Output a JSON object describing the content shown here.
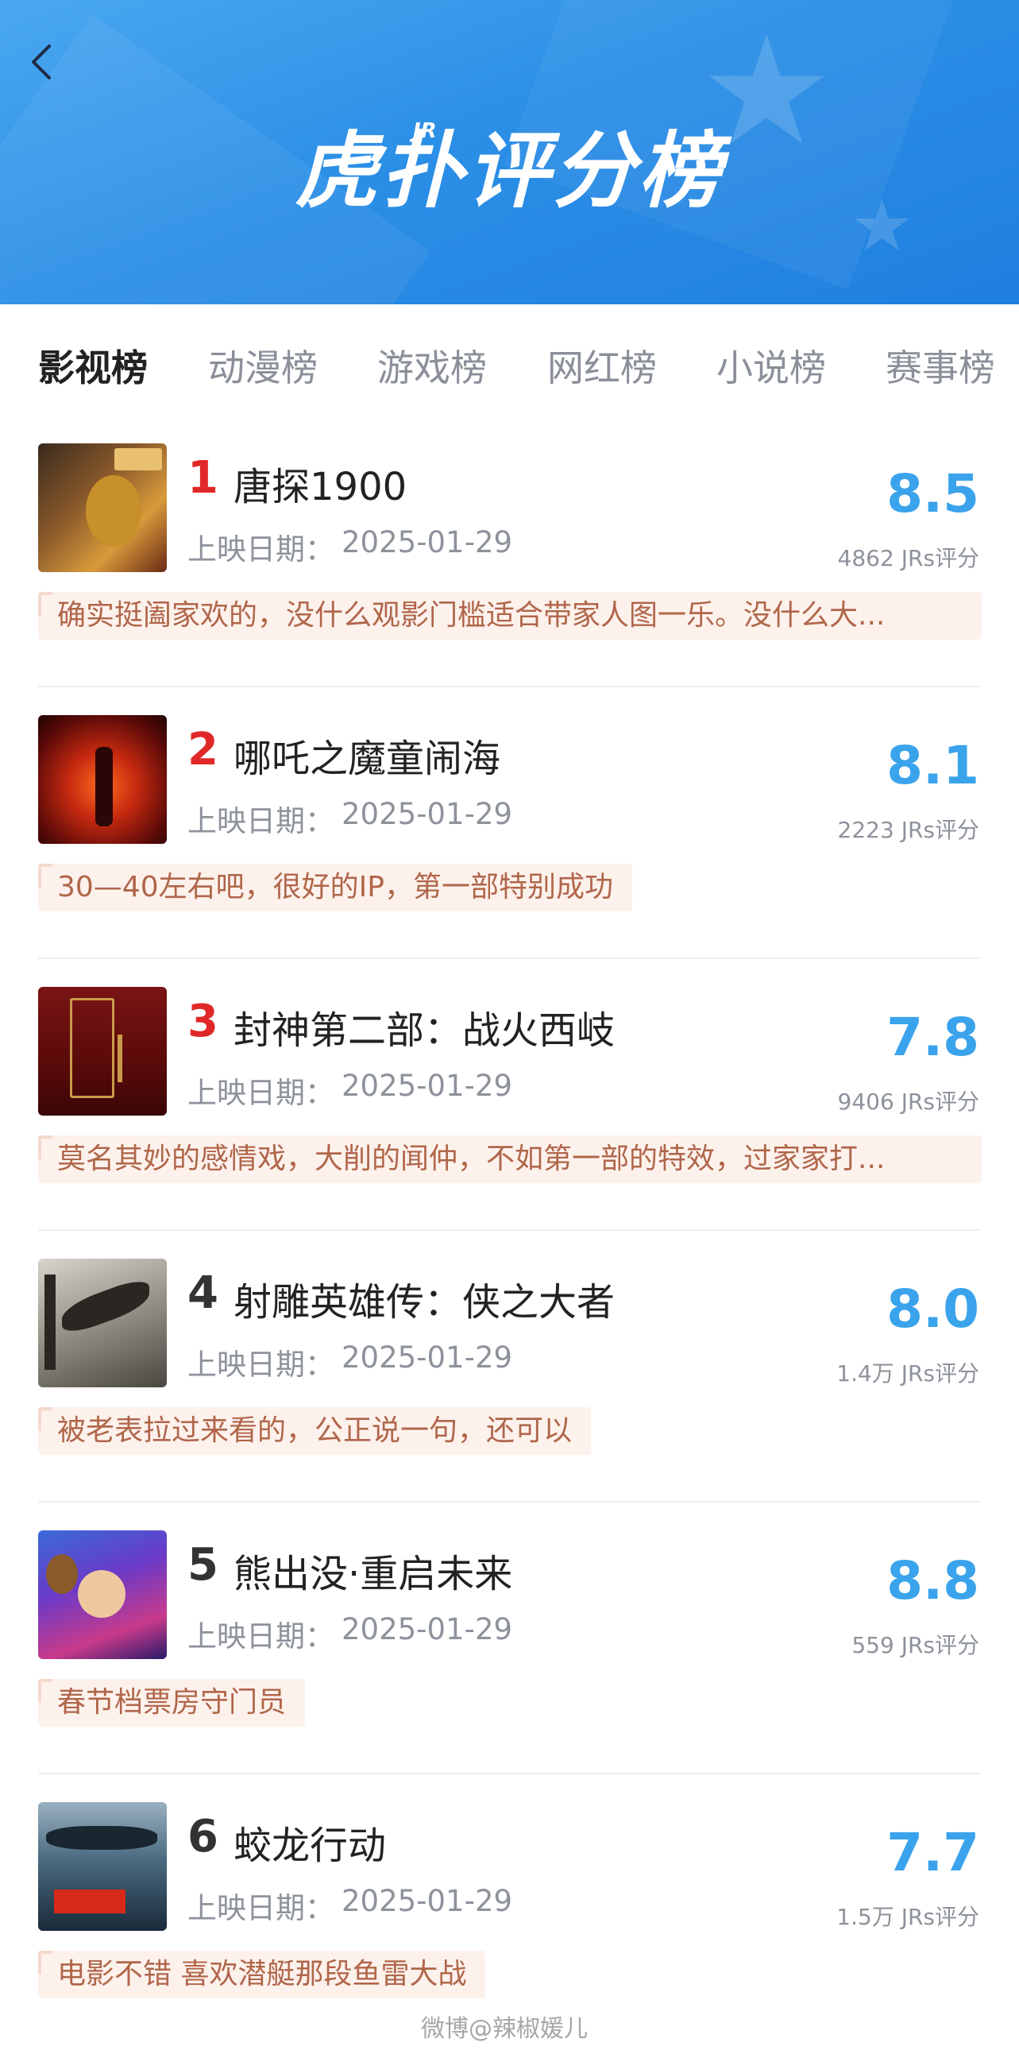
{
  "header": {
    "brand_sup": "JR",
    "brand": "虎扑评分榜"
  },
  "tabs": [
    "影视榜",
    "动漫榜",
    "游戏榜",
    "网红榜",
    "小说榜",
    "赛事榜"
  ],
  "date_label": "上映日期：",
  "items": [
    {
      "rank": "1",
      "title": "唐探1900",
      "date": "2025-01-29",
      "score": "8.5",
      "count": "4862 JRs评分",
      "comment": "确实挺阖家欢的，没什么观影门槛适合带家人图一乐。没什么大..."
    },
    {
      "rank": "2",
      "title": "哪吒之魔童闹海",
      "date": "2025-01-29",
      "score": "8.1",
      "count": "2223 JRs评分",
      "comment": "30—40左右吧，很好的IP，第一部特别成功"
    },
    {
      "rank": "3",
      "title": "封神第二部：战火西岐",
      "date": "2025-01-29",
      "score": "7.8",
      "count": "9406 JRs评分",
      "comment": "莫名其妙的感情戏，大削的闻仲，不如第一部的特效，过家家打..."
    },
    {
      "rank": "4",
      "title": "射雕英雄传：侠之大者",
      "date": "2025-01-29",
      "score": "8.0",
      "count": "1.4万 JRs评分",
      "comment": "被老表拉过来看的，公正说一句，还可以"
    },
    {
      "rank": "5",
      "title": "熊出没·重启未来",
      "date": "2025-01-29",
      "score": "8.8",
      "count": "559 JRs评分",
      "comment": "春节档票房守门员"
    },
    {
      "rank": "6",
      "title": "蛟龙行动",
      "date": "2025-01-29",
      "score": "7.7",
      "count": "1.5万 JRs评分",
      "comment": "电影不错 喜欢潜艇那段鱼雷大战"
    }
  ],
  "watermark": "微博@辣椒媛儿",
  "colors": {
    "accent": "#3aa3ec",
    "header": "#2b8fe6",
    "rank_top": "#e02828",
    "comment_bg": "#fdf1ec",
    "comment_text": "#b0664a"
  }
}
